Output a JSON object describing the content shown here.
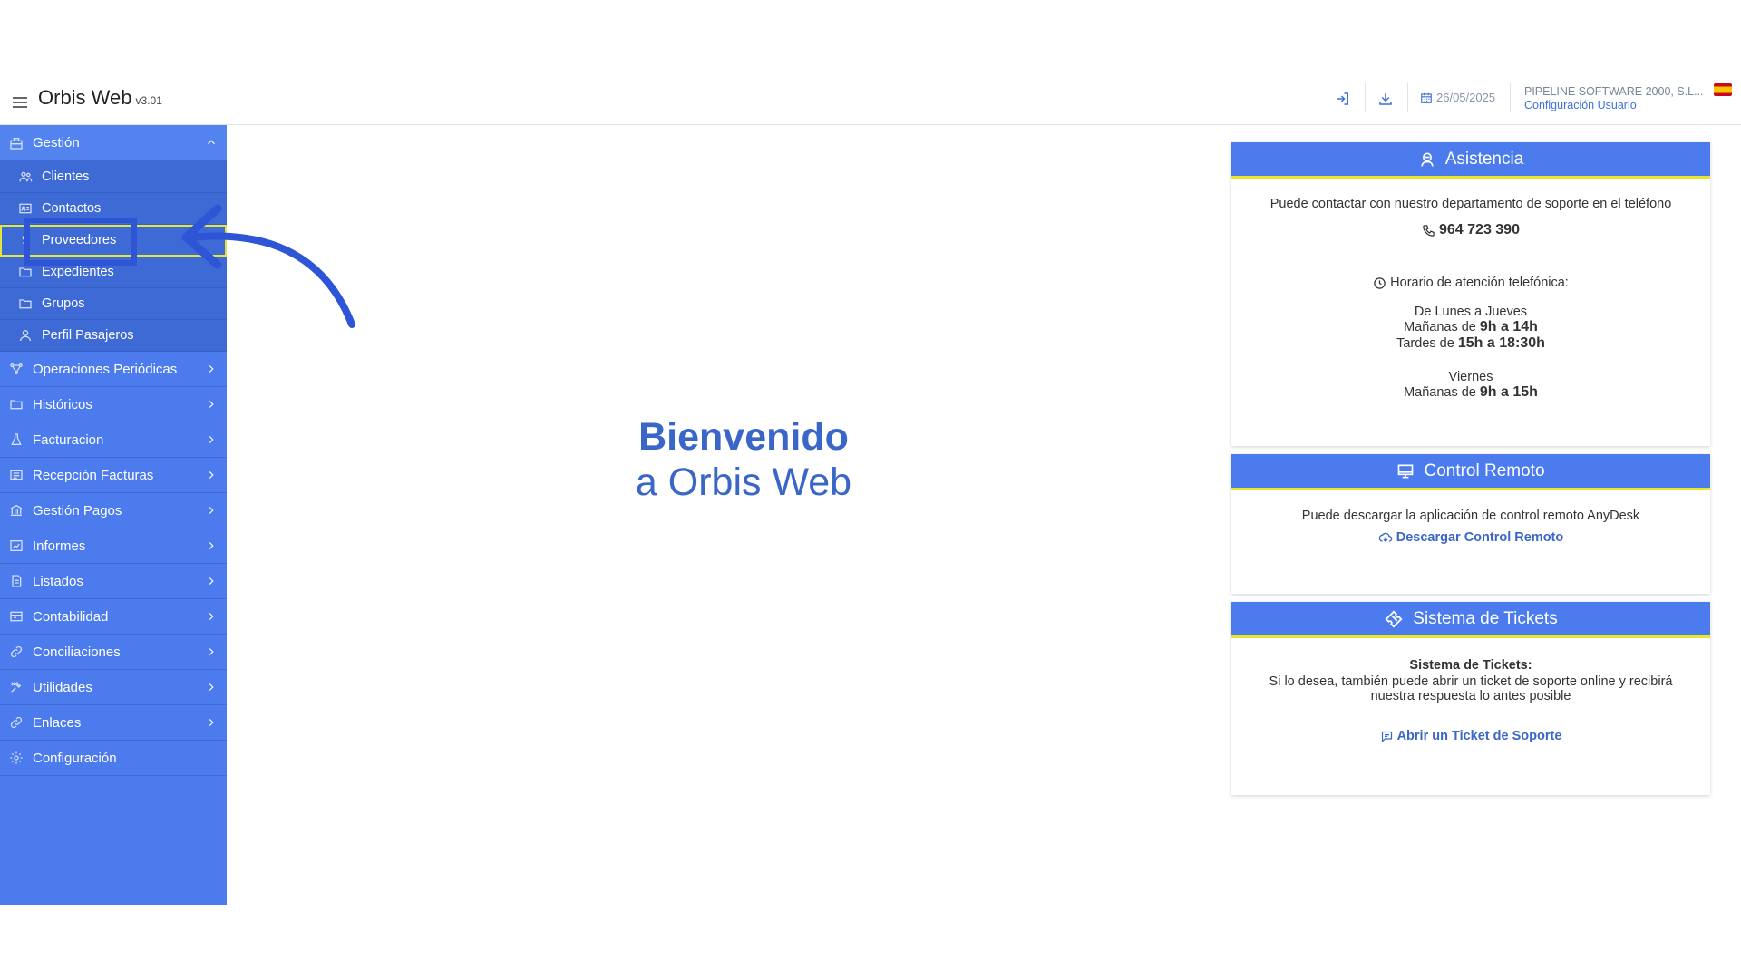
{
  "header": {
    "app_title": "Orbis Web",
    "version": "v3.01",
    "date": "26/05/2025",
    "company": "PIPELINE SOFTWARE 2000, S.L...",
    "config_link": "Configuración Usuario",
    "icons": [
      "login-icon",
      "download-icon",
      "calendar-icon"
    ],
    "flag": "spain-flag-icon"
  },
  "sidebar": {
    "group": {
      "label": "Gestión",
      "icon": "building-icon"
    },
    "sub_items": [
      {
        "label": "Clientes",
        "icon": "users-icon"
      },
      {
        "label": "Contactos",
        "icon": "contact-card-icon"
      },
      {
        "label": "Proveedores",
        "icon": "dollar-icon",
        "active": true
      },
      {
        "label": "Expedientes",
        "icon": "folder-icon"
      },
      {
        "label": "Grupos",
        "icon": "folder-icon"
      },
      {
        "label": "Perfil Pasajeros",
        "icon": "user-icon"
      }
    ],
    "items": [
      {
        "label": "Operaciones Periódicas",
        "icon": "nodes-icon"
      },
      {
        "label": "Históricos",
        "icon": "folder-icon"
      },
      {
        "label": "Facturacion",
        "icon": "flask-icon"
      },
      {
        "label": "Recepción Facturas",
        "icon": "list-icon"
      },
      {
        "label": "Gestión Pagos",
        "icon": "bank-icon"
      },
      {
        "label": "Informes",
        "icon": "report-icon"
      },
      {
        "label": "Listados",
        "icon": "document-icon"
      },
      {
        "label": "Contabilidad",
        "icon": "ledger-icon"
      },
      {
        "label": "Conciliaciones",
        "icon": "link-icon"
      },
      {
        "label": "Utilidades",
        "icon": "tools-icon"
      },
      {
        "label": "Enlaces",
        "icon": "link-icon"
      },
      {
        "label": "Configuración",
        "icon": "gear-icon"
      }
    ]
  },
  "welcome": {
    "line1": "Bienvenido",
    "line2": "a Orbis Web"
  },
  "asistencia": {
    "title": "Asistencia",
    "contact_text": "Puede contactar con nuestro departamento de soporte en el teléfono",
    "phone": "964 723 390",
    "hours_title": "Horario de atención telefónica:",
    "mon_thu": "De Lunes a Jueves",
    "morning_label": "Mañanas de",
    "morning_hours": "9h a 14h",
    "afternoon_label": "Tardes de",
    "afternoon_hours": "15h a 18:30h",
    "friday": "Viernes",
    "friday_morning_label": "Mañanas de",
    "friday_hours": "9h a 15h"
  },
  "control_remoto": {
    "title": "Control Remoto",
    "text": "Puede descargar la aplicación de control remoto AnyDesk",
    "link": "Descargar Control Remoto"
  },
  "tickets": {
    "title": "Sistema de Tickets",
    "bold": "Sistema de Tickets:",
    "text": "Si lo desea, también puede abrir un ticket de soporte online y recibirá nuestra respuesta lo antes posible",
    "link": "Abrir un Ticket de Soporte"
  },
  "colors": {
    "accent": "#4b7bec",
    "highlight": "#e9e62a",
    "annotation": "#2d55d6"
  }
}
